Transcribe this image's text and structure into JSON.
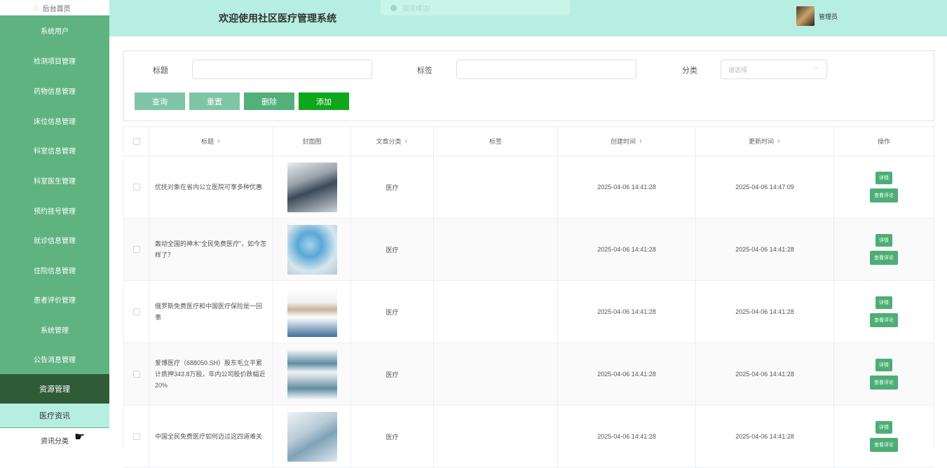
{
  "sidebar": {
    "home": "后台首页",
    "items": [
      "系统用户",
      "检测项目管理",
      "药物信息管理",
      "床位信息管理",
      "科室信息管理",
      "科室医生管理",
      "预约挂号管理",
      "就诊信息管理",
      "住院信息管理",
      "患者评价管理",
      "系统管理",
      "公告消息管理"
    ],
    "active": "资源管理",
    "sub1": "医疗资讯",
    "sub2": "资讯分类"
  },
  "header": {
    "title": "欢迎使用社区医疗管理系统",
    "admin": "管理员"
  },
  "toast": {
    "text": "提交成功!"
  },
  "search": {
    "title_label": "标题",
    "tag_label": "标签",
    "category_label": "分类",
    "category_placeholder": "请选择",
    "btn_query": "查询",
    "btn_reset": "重置",
    "btn_delete": "删除",
    "btn_add": "添加"
  },
  "table": {
    "headers": {
      "title": "标题",
      "cover": "封面图",
      "category": "文章分类",
      "tag": "标签",
      "created": "创建时间",
      "updated": "更新时间",
      "ops": "操作"
    },
    "detail_label": "详情",
    "comment_label": "查看评论",
    "rows": [
      {
        "title": "优抚对象在省内公立医院可享多种优惠",
        "category": "医疗",
        "tag": "",
        "created": "2025-04-06 14:41:28",
        "updated": "2025-04-06 14:47:09"
      },
      {
        "title": "轰动全国的神木“全民免费医疗”，如今怎样了？",
        "category": "医疗",
        "tag": "",
        "created": "2025-04-06 14:41:28",
        "updated": "2025-04-06 14:41:28"
      },
      {
        "title": "俄罗斯免费医疗和中国医疗保险是一回事",
        "category": "医疗",
        "tag": "",
        "created": "2025-04-06 14:41:28",
        "updated": "2025-04-06 14:41:28"
      },
      {
        "title": "爱博医疗（688050.SH）股东毛立平累计质押343.8万股，年内公司股价跌幅近20%",
        "category": "医疗",
        "tag": "",
        "created": "2025-04-06 14:41:28",
        "updated": "2025-04-06 14:41:28"
      },
      {
        "title": "中国全民免费医疗如何迈过这四道难关",
        "category": "医疗",
        "tag": "",
        "created": "2025-04-06 14:41:28",
        "updated": "2025-04-06 14:41:28"
      }
    ]
  },
  "colors": {
    "sidebar": "#5fb380",
    "sidebar_active": "#2f5b36",
    "header": "#b6efe2",
    "btn_query": "#7fc4a7",
    "btn_reset": "#80c4a6",
    "btn_delete": "#53b07a",
    "btn_add": "#0fa81c",
    "op_button": "#4cae76"
  }
}
